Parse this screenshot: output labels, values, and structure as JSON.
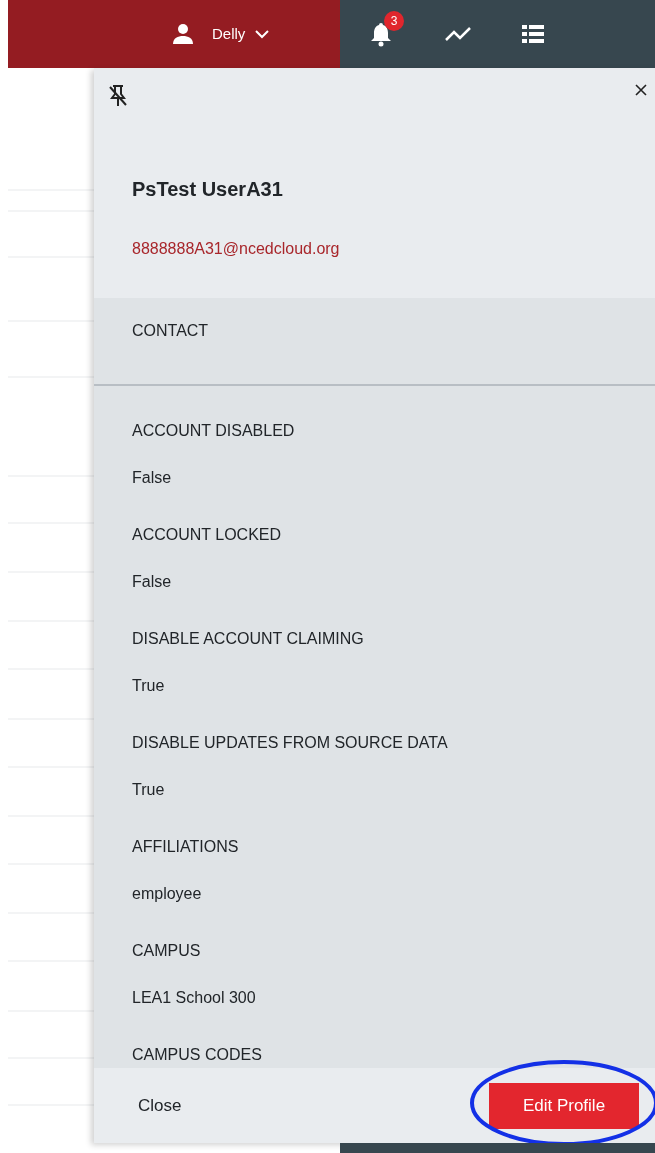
{
  "header": {
    "user_name": "Delly",
    "notification_count": "3"
  },
  "panel": {
    "name": "PsTest UserA31",
    "email": "8888888A31@ncedcloud.org",
    "section_title": "CONTACT",
    "fields": [
      {
        "label": "ACCOUNT DISABLED",
        "value": "False"
      },
      {
        "label": "ACCOUNT LOCKED",
        "value": "False"
      },
      {
        "label": "DISABLE ACCOUNT CLAIMING",
        "value": "True"
      },
      {
        "label": "DISABLE UPDATES FROM SOURCE DATA",
        "value": "True"
      },
      {
        "label": "AFFILIATIONS",
        "value": "employee"
      },
      {
        "label": "CAMPUS",
        "value": "LEA1 School 300"
      },
      {
        "label": "CAMPUS CODES"
      }
    ],
    "close_label": "Close",
    "edit_button": {
      "label": "Edit Profile",
      "highlighted": true
    }
  }
}
